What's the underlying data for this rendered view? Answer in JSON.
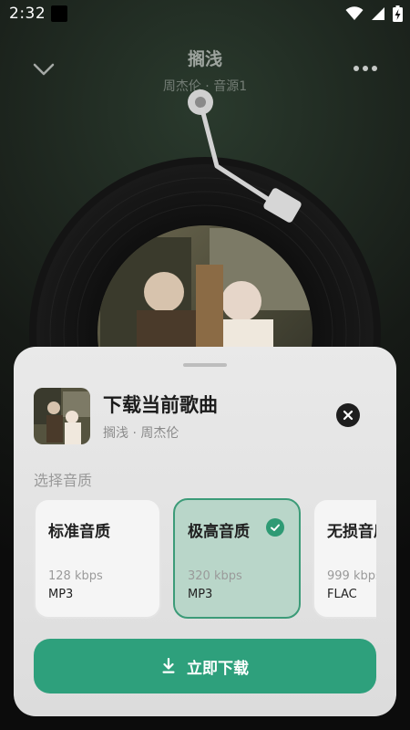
{
  "status": {
    "time": "2:32"
  },
  "header": {
    "title": "搁浅",
    "subtitle": "周杰伦 · 音源1",
    "back_icon": "chevron-down-icon",
    "more_icon": "more-horizontal-icon"
  },
  "sheet": {
    "title": "下载当前歌曲",
    "subtitle": "搁浅 · 周杰伦",
    "section_label": "选择音质",
    "qualities": [
      {
        "name": "标准音质",
        "bitrate": "128 kbps",
        "format": "MP3",
        "selected": false
      },
      {
        "name": "极高音质",
        "bitrate": "320 kbps",
        "format": "MP3",
        "selected": true
      },
      {
        "name": "无损音质",
        "bitrate": "999 kbps",
        "format": "FLAC",
        "selected": false
      }
    ],
    "download_label": "立即下载"
  },
  "colors": {
    "accent": "#2ea07c",
    "selected_card_bg": "#b9d6c9",
    "selected_card_border": "#3c9b78",
    "sheet_bg": "#e5e5e5"
  }
}
